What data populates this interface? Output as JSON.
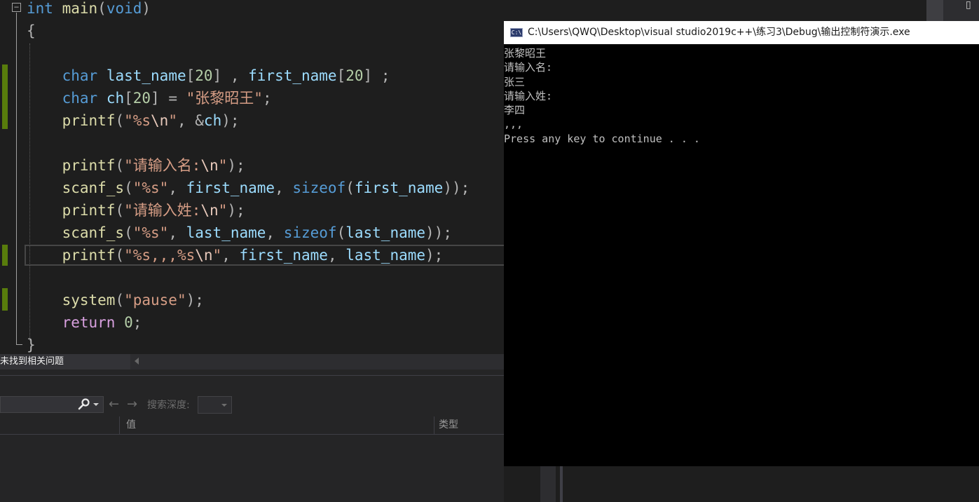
{
  "editor": {
    "lines": [
      [
        {
          "c": "kw",
          "t": "int"
        },
        {
          "c": "pun",
          "t": " "
        },
        {
          "c": "fn",
          "t": "main"
        },
        {
          "c": "pun",
          "t": "("
        },
        {
          "c": "kw",
          "t": "void"
        },
        {
          "c": "pun",
          "t": ")"
        }
      ],
      [
        {
          "c": "pun",
          "t": "{"
        }
      ],
      [],
      [
        {
          "c": "pun",
          "t": "    "
        },
        {
          "c": "kw",
          "t": "char"
        },
        {
          "c": "pun",
          "t": " "
        },
        {
          "c": "var",
          "t": "last_name"
        },
        {
          "c": "pun",
          "t": "["
        },
        {
          "c": "num",
          "t": "20"
        },
        {
          "c": "pun",
          "t": "] , "
        },
        {
          "c": "var",
          "t": "first_name"
        },
        {
          "c": "pun",
          "t": "["
        },
        {
          "c": "num",
          "t": "20"
        },
        {
          "c": "pun",
          "t": "] ;"
        }
      ],
      [
        {
          "c": "pun",
          "t": "    "
        },
        {
          "c": "kw",
          "t": "char"
        },
        {
          "c": "pun",
          "t": " "
        },
        {
          "c": "var",
          "t": "ch"
        },
        {
          "c": "pun",
          "t": "["
        },
        {
          "c": "num",
          "t": "20"
        },
        {
          "c": "pun",
          "t": "] = "
        },
        {
          "c": "str",
          "t": "\"张黎昭王\""
        },
        {
          "c": "pun",
          "t": ";"
        }
      ],
      [
        {
          "c": "pun",
          "t": "    "
        },
        {
          "c": "fn",
          "t": "printf"
        },
        {
          "c": "pun",
          "t": "("
        },
        {
          "c": "str",
          "t": "\"%s"
        },
        {
          "c": "esc",
          "t": "\\n"
        },
        {
          "c": "str",
          "t": "\""
        },
        {
          "c": "pun",
          "t": ", &"
        },
        {
          "c": "var",
          "t": "ch"
        },
        {
          "c": "pun",
          "t": ");"
        }
      ],
      [],
      [
        {
          "c": "pun",
          "t": "    "
        },
        {
          "c": "fn",
          "t": "printf"
        },
        {
          "c": "pun",
          "t": "("
        },
        {
          "c": "str",
          "t": "\"请输入名:"
        },
        {
          "c": "esc",
          "t": "\\n"
        },
        {
          "c": "str",
          "t": "\""
        },
        {
          "c": "pun",
          "t": ");"
        }
      ],
      [
        {
          "c": "pun",
          "t": "    "
        },
        {
          "c": "fn",
          "t": "scanf_s"
        },
        {
          "c": "pun",
          "t": "("
        },
        {
          "c": "str",
          "t": "\"%s\""
        },
        {
          "c": "pun",
          "t": ", "
        },
        {
          "c": "var",
          "t": "first_name"
        },
        {
          "c": "pun",
          "t": ", "
        },
        {
          "c": "kwfn",
          "t": "sizeof"
        },
        {
          "c": "pun",
          "t": "("
        },
        {
          "c": "var",
          "t": "first_name"
        },
        {
          "c": "pun",
          "t": "));"
        }
      ],
      [
        {
          "c": "pun",
          "t": "    "
        },
        {
          "c": "fn",
          "t": "printf"
        },
        {
          "c": "pun",
          "t": "("
        },
        {
          "c": "str",
          "t": "\"请输入姓:"
        },
        {
          "c": "esc",
          "t": "\\n"
        },
        {
          "c": "str",
          "t": "\""
        },
        {
          "c": "pun",
          "t": ");"
        }
      ],
      [
        {
          "c": "pun",
          "t": "    "
        },
        {
          "c": "fn",
          "t": "scanf_s"
        },
        {
          "c": "pun",
          "t": "("
        },
        {
          "c": "str",
          "t": "\"%s\""
        },
        {
          "c": "pun",
          "t": ", "
        },
        {
          "c": "var",
          "t": "last_name"
        },
        {
          "c": "pun",
          "t": ", "
        },
        {
          "c": "kwfn",
          "t": "sizeof"
        },
        {
          "c": "pun",
          "t": "("
        },
        {
          "c": "var",
          "t": "last_name"
        },
        {
          "c": "pun",
          "t": "));"
        }
      ],
      [
        {
          "c": "pun",
          "t": "    "
        },
        {
          "c": "fn",
          "t": "printf"
        },
        {
          "c": "pun",
          "t": "("
        },
        {
          "c": "str",
          "t": "\"%s,,,%s"
        },
        {
          "c": "esc",
          "t": "\\n"
        },
        {
          "c": "str",
          "t": "\""
        },
        {
          "c": "pun",
          "t": ", "
        },
        {
          "c": "var",
          "t": "first_name"
        },
        {
          "c": "pun",
          "t": ", "
        },
        {
          "c": "var",
          "t": "last_name"
        },
        {
          "c": "pun",
          "t": ");"
        }
      ],
      [],
      [
        {
          "c": "pun",
          "t": "    "
        },
        {
          "c": "fn",
          "t": "system"
        },
        {
          "c": "pun",
          "t": "("
        },
        {
          "c": "str",
          "t": "\"pause\""
        },
        {
          "c": "pun",
          "t": ");"
        }
      ],
      [
        {
          "c": "pun",
          "t": "    "
        },
        {
          "c": "ctl",
          "t": "return"
        },
        {
          "c": "pun",
          "t": " "
        },
        {
          "c": "num",
          "t": "0"
        },
        {
          "c": "pun",
          "t": ";"
        }
      ],
      [
        {
          "c": "pun",
          "t": "}"
        }
      ]
    ],
    "fold_symbol": "−",
    "change_colors": {
      "modified": "#587c0c"
    }
  },
  "status": {
    "issues_text": "未找到相关问题"
  },
  "watch": {
    "search_depth_label": "搜索深度:",
    "columns": {
      "value": "值",
      "type": "类型"
    }
  },
  "console": {
    "icon_text": "C:\\",
    "title": "C:\\Users\\QWQ\\Desktop\\visual studio2019c++\\练习3\\Debug\\输出控制符演示.exe",
    "output": [
      "张黎昭王",
      "请输入名:",
      "张三",
      "请输入姓:",
      "李四",
      ",,,",
      "Press any key to continue . . ."
    ]
  }
}
